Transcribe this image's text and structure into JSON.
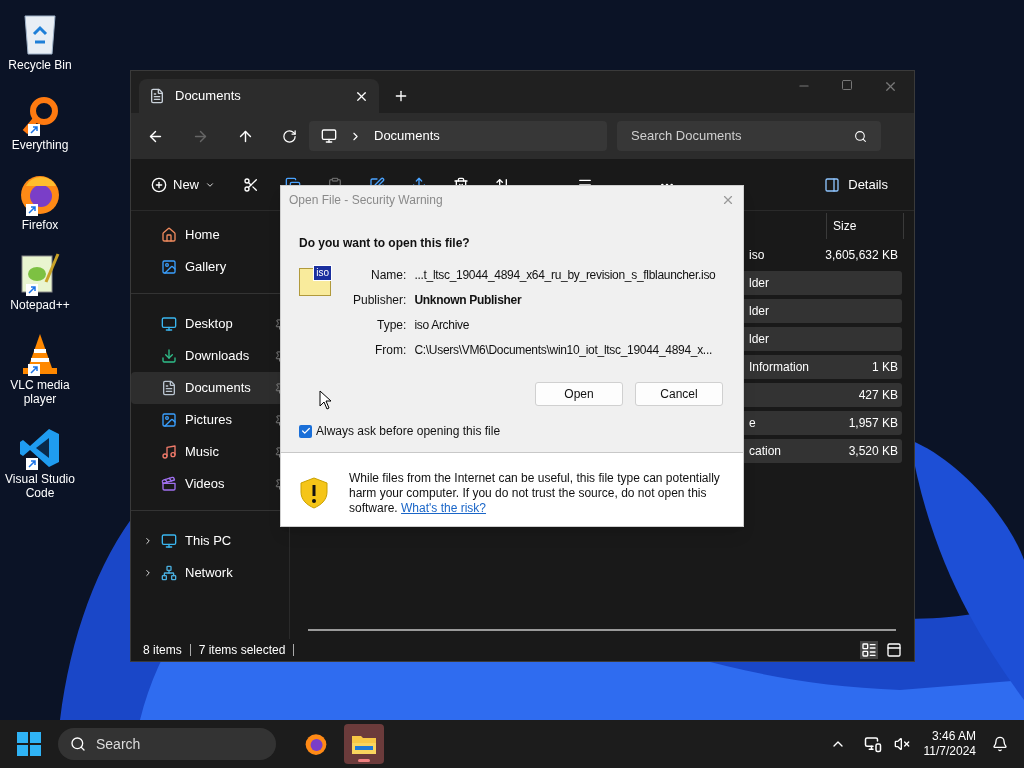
{
  "desktop_icons": [
    {
      "label": "Recycle Bin",
      "kind": "bin",
      "shortcut": false
    },
    {
      "label": "Everything",
      "kind": "magnifier",
      "shortcut": true
    },
    {
      "label": "Firefox",
      "kind": "browser",
      "shortcut": true
    },
    {
      "label": "Notepad++",
      "kind": "notepad",
      "shortcut": true
    },
    {
      "label": "VLC media player",
      "kind": "cone",
      "shortcut": true
    },
    {
      "label": "Visual Studio Code",
      "kind": "code",
      "shortcut": true
    }
  ],
  "explorer": {
    "tab": {
      "title": "Documents"
    },
    "address": {
      "location": "Documents"
    },
    "search": {
      "placeholder": "Search Documents"
    },
    "toolbar": {
      "new_label": "New",
      "details_label": "Details"
    },
    "sidebar": [
      [
        {
          "label": "Home",
          "kind": "home",
          "selected": false
        },
        {
          "label": "Gallery",
          "kind": "gallery",
          "selected": false
        }
      ],
      [
        {
          "label": "Desktop",
          "kind": "desktop",
          "selected": false,
          "pinned": true
        },
        {
          "label": "Downloads",
          "kind": "downloads",
          "selected": false,
          "pinned": true
        },
        {
          "label": "Documents",
          "kind": "documents",
          "selected": true,
          "pinned": true
        },
        {
          "label": "Pictures",
          "kind": "pictures",
          "selected": false,
          "pinned": true
        },
        {
          "label": "Music",
          "kind": "music",
          "selected": false,
          "pinned": true
        },
        {
          "label": "Videos",
          "kind": "videos",
          "selected": false,
          "pinned": true
        }
      ],
      [
        {
          "label": "This PC",
          "kind": "pc",
          "selected": false,
          "expanded": false
        },
        {
          "label": "Network",
          "kind": "network",
          "selected": false,
          "expanded": false
        }
      ]
    ],
    "file_list": {
      "columns": [
        {
          "label": "Size"
        }
      ],
      "rows": [
        {
          "column_1": "iso",
          "size": "3,605,632 KB",
          "selected": false
        },
        {
          "column_1": "lder",
          "size": "",
          "selected": true
        },
        {
          "column_1": "lder",
          "size": "",
          "selected": true
        },
        {
          "column_1": "lder",
          "size": "",
          "selected": true
        },
        {
          "column_1": "Information",
          "size": "1 KB",
          "selected": true
        },
        {
          "column_1": "",
          "size": "427 KB",
          "selected": true
        },
        {
          "column_1": "e",
          "size": "1,957 KB",
          "selected": true
        },
        {
          "column_1": "cation",
          "size": "3,520 KB",
          "selected": true
        }
      ]
    },
    "status_bar": {
      "count": "8 items",
      "selection": "7 items selected"
    }
  },
  "dialog": {
    "title": "Open File - Security Warning",
    "question": "Do you want to open this file?",
    "file_icon_label": "iso",
    "fields": [
      {
        "label": "Name:",
        "value": "...t_ltsc_19044_4894_x64_ru_by_revision_s_flblauncher.iso",
        "bold": false
      },
      {
        "label": "Publisher:",
        "value": "Unknown Publisher",
        "bold": true
      },
      {
        "label": "Type:",
        "value": "iso Archive",
        "bold": false
      },
      {
        "label": "From:",
        "value": "C:\\Users\\VM6\\Documents\\win10_iot_ltsc_19044_4894_x...",
        "bold": false
      }
    ],
    "buttons": [
      "Open",
      "Cancel"
    ],
    "checkbox": {
      "label": "Always ask before opening this file",
      "checked": true
    },
    "warning": {
      "text": "While files from the Internet can be useful, this file type can potentially harm your computer. If you do not trust the source, do not open this software.",
      "link": "What's the risk?"
    }
  },
  "taskbar": {
    "search": {
      "placeholder": "Search"
    },
    "apps": [
      {
        "kind": "browser",
        "active": false
      },
      {
        "kind": "explorer",
        "active": true
      }
    ],
    "time": "3:46 AM",
    "date": "11/7/2024"
  }
}
